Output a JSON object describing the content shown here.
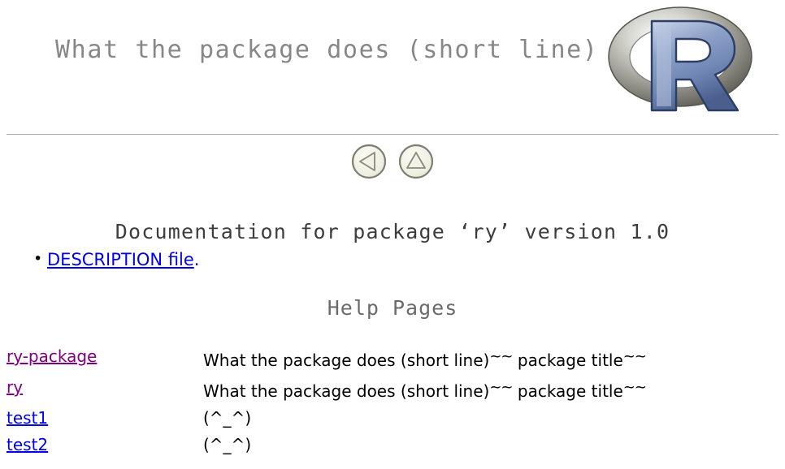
{
  "header": {
    "title": "What the package does (short line)",
    "logo_alt": "R logo"
  },
  "nav": {
    "back_label": "Back",
    "up_label": "Up"
  },
  "doc": {
    "title": "Documentation for package ‘ry’ version 1.0"
  },
  "description": {
    "link_label": "DESCRIPTION file",
    "trailing_punctuation": "."
  },
  "help": {
    "heading": "Help Pages",
    "rows": [
      {
        "name": "ry-package",
        "visited": true,
        "desc_prefix": "What the package does (short line)",
        "tilde_mid": "~~",
        "desc_mid": "package title",
        "tilde_end": "~~"
      },
      {
        "name": "ry",
        "visited": true,
        "desc_prefix": "What the package does (short line)",
        "tilde_mid": "~~",
        "desc_mid": "package title",
        "tilde_end": "~~"
      },
      {
        "name": "test1",
        "visited": false,
        "desc_prefix": "(^_^)",
        "tilde_mid": "",
        "desc_mid": "",
        "tilde_end": ""
      },
      {
        "name": "test2",
        "visited": false,
        "desc_prefix": "(^_^)",
        "tilde_mid": "",
        "desc_mid": "",
        "tilde_end": ""
      }
    ]
  },
  "colors": {
    "link_unvisited": "#0000ee",
    "link_visited": "#800080",
    "header_title": "#878787",
    "heading_gray": "#6b6b6b",
    "rule": "#a9a9a9"
  }
}
